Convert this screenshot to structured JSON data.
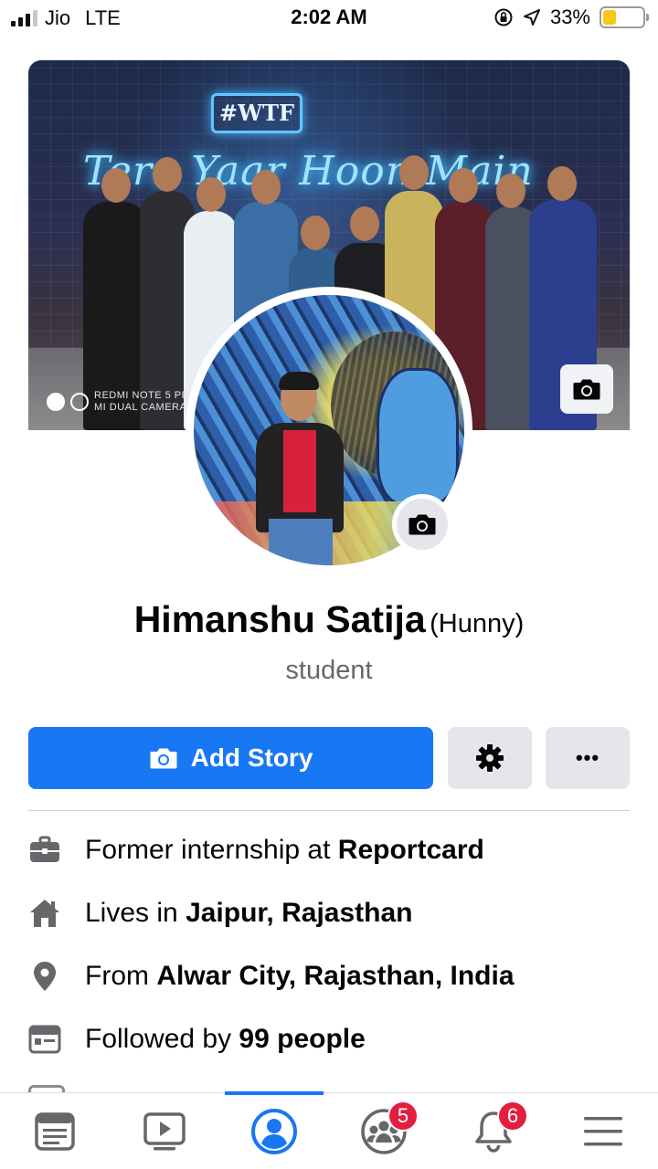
{
  "status_bar": {
    "carrier": "Jio",
    "network": "LTE",
    "time": "2:02 AM",
    "battery_percent": "33%",
    "battery_level": 0.33,
    "icons": [
      "signal-icon",
      "orientation-lock-icon",
      "location-arrow-icon",
      "battery-icon"
    ]
  },
  "cover": {
    "neon_sign": "#WTF",
    "neon_text": "Tera Yaar Hoon Main",
    "watermark_line1": "REDMI NOTE 5 PRO",
    "watermark_line2": "MI DUAL CAMERA",
    "camera_icon": "camera-icon"
  },
  "profile": {
    "name": "Himanshu Satija",
    "nickname": "(Hunny)",
    "bio": "student"
  },
  "actions": {
    "add_story_label": "Add Story",
    "add_story_icon": "camera-icon",
    "settings_icon": "gear-icon",
    "more_icon": "more-dots-icon",
    "more_label": "•••"
  },
  "info": [
    {
      "icon": "briefcase-icon",
      "prefix": "Former internship at ",
      "bold": "Reportcard"
    },
    {
      "icon": "home-icon",
      "prefix": "Lives in ",
      "bold": "Jaipur, Rajasthan"
    },
    {
      "icon": "location-pin-icon",
      "prefix": "From ",
      "bold": "Alwar City, Rajasthan, India"
    },
    {
      "icon": "followers-icon",
      "prefix": "Followed by ",
      "bold": "99 people"
    }
  ],
  "bottom_nav": {
    "items": [
      {
        "icon": "news-feed-icon"
      },
      {
        "icon": "watch-video-icon"
      },
      {
        "icon": "profile-icon",
        "active": true
      },
      {
        "icon": "groups-icon",
        "badge": "5"
      },
      {
        "icon": "notifications-bell-icon",
        "badge": "6"
      },
      {
        "icon": "menu-icon"
      }
    ]
  },
  "colors": {
    "accent": "#1877f2",
    "secondary_button": "#e4e6eb",
    "badge": "#e41e3f",
    "muted_text": "#65676b",
    "icon_gray": "#65676b"
  }
}
